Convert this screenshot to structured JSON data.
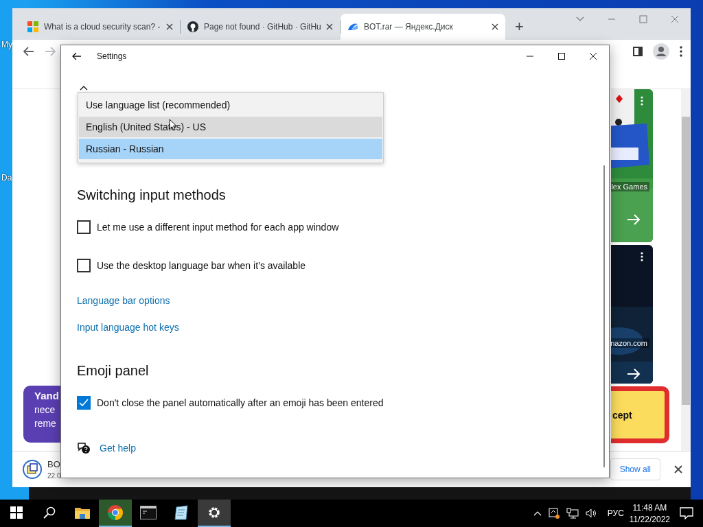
{
  "desktop": {
    "icons": [
      {
        "label": "My"
      },
      {
        "label": "Da"
      }
    ]
  },
  "browser": {
    "tabs": [
      {
        "title": "What is a cloud security scan? -",
        "kind": "microsoft",
        "selected": false
      },
      {
        "title": "Page not found · GitHub · GitHu",
        "kind": "github",
        "selected": false
      },
      {
        "title": "BOT.rar — Яндекс.Диск",
        "kind": "disk",
        "selected": true
      }
    ],
    "new_tab": "+",
    "page": {
      "promo": {
        "title": "Yand",
        "lines": [
          "nece",
          "reme"
        ]
      },
      "cards": [
        {
          "kind": "games",
          "caption": "lex Games"
        },
        {
          "kind": "dark",
          "caption": "nazon.com"
        }
      ],
      "accept_button": "cept",
      "download": {
        "name": "BO",
        "detail": "22.0"
      },
      "show_all": "Show all"
    }
  },
  "settings": {
    "title": "Settings",
    "dropdown": {
      "options": [
        {
          "label": "Use language list (recommended)",
          "hovered": false,
          "selected": false
        },
        {
          "label": "English (United States) - US",
          "hovered": true,
          "selected": false
        },
        {
          "label": "Russian - Russian",
          "hovered": false,
          "selected": true
        }
      ]
    },
    "items": [
      {
        "kind": "heading",
        "text": "Switching input methods"
      },
      {
        "kind": "checkbox",
        "text": "Let me use a different input method for each app window",
        "checked": false
      },
      {
        "kind": "checkbox",
        "text": "Use the desktop language bar when it’s available",
        "checked": false
      },
      {
        "kind": "link",
        "text": "Language bar options"
      },
      {
        "kind": "link",
        "text": "Input language hot keys"
      },
      {
        "kind": "heading",
        "text": "Emoji panel"
      },
      {
        "kind": "checkbox",
        "text": "Don't close the panel automatically after an emoji has been entered",
        "checked": true
      },
      {
        "kind": "help",
        "text": "Get help"
      }
    ]
  },
  "taskbar": {
    "apps": [
      {
        "kind": "start",
        "active": false
      },
      {
        "kind": "search",
        "active": false
      },
      {
        "kind": "explorer",
        "active": false
      },
      {
        "kind": "chrome",
        "active": true
      },
      {
        "kind": "terminal",
        "active": false
      },
      {
        "kind": "notepad",
        "active": false
      },
      {
        "kind": "settings",
        "active": true
      }
    ],
    "language": "РУС",
    "time": "11:48 AM",
    "date": "11/22/2022"
  }
}
